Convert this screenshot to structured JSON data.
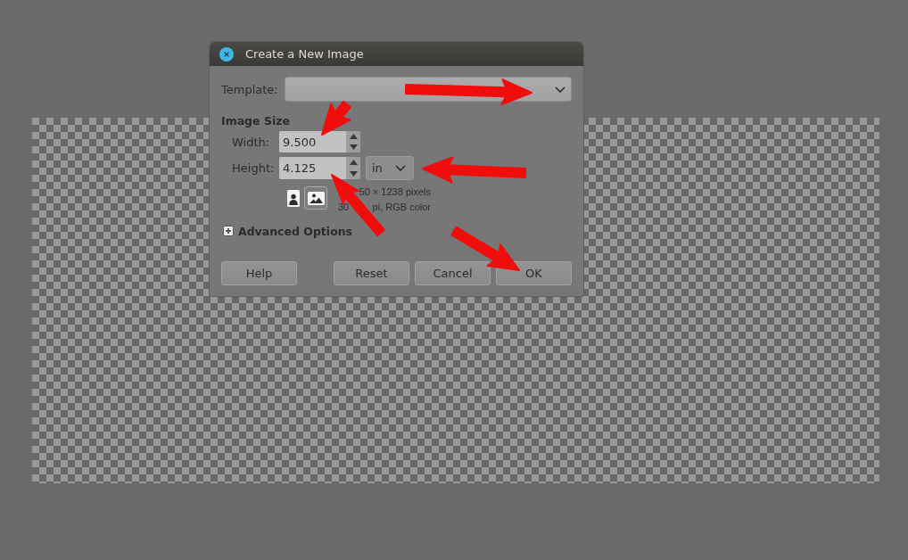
{
  "dialog": {
    "title": "Create a New Image",
    "template": {
      "label": "Template:"
    },
    "image_size": {
      "heading": "Image Size",
      "width": {
        "label": "Width:",
        "value": "9.500"
      },
      "height": {
        "label": "Height:",
        "value": "4.125"
      },
      "unit": "in",
      "orientation": [
        {
          "kind": "portrait",
          "selected": false
        },
        {
          "kind": "landscape",
          "selected": true
        }
      ],
      "info_line_1": "50 × 1238 pixels",
      "info_line_2": [
        "30",
        "pi, RGB color"
      ]
    },
    "advanced_options": {
      "label": "Advanced Options",
      "expanded": false
    },
    "buttons": {
      "left": [
        {
          "label": "Help"
        }
      ],
      "right": [
        {
          "label": "Reset"
        },
        {
          "label": "Cancel"
        },
        {
          "label": "OK"
        }
      ]
    }
  }
}
